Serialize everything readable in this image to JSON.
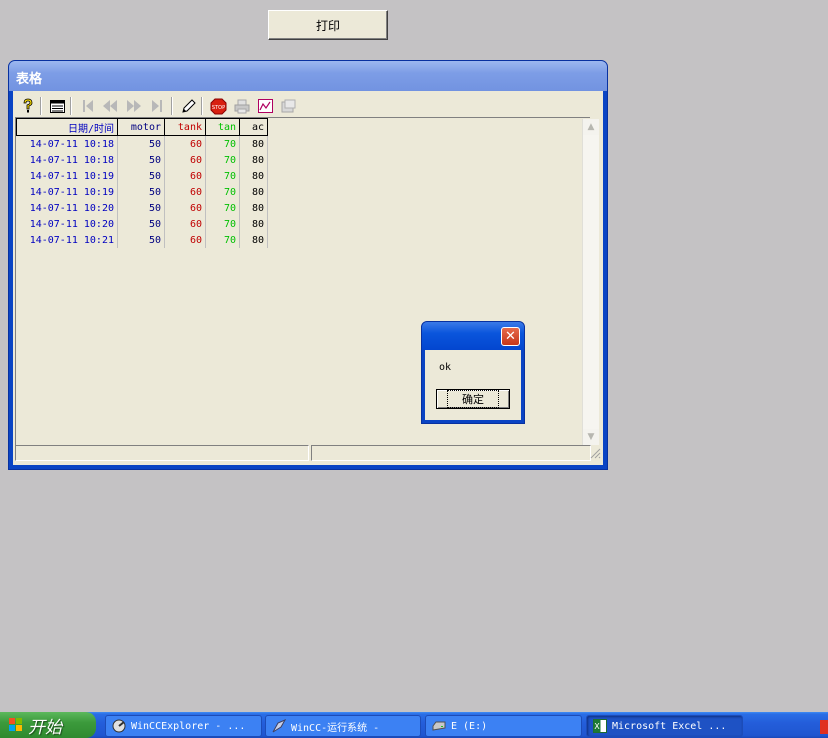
{
  "print_button": {
    "label": "打印"
  },
  "window": {
    "title": "表格"
  },
  "toolbar": {
    "icons": [
      "help-icon",
      "table-select-icon",
      "first-record-icon",
      "previous-page-icon",
      "next-page-icon",
      "last-record-icon",
      "edit-icon",
      "stop-icon",
      "print-icon",
      "chart-icon",
      "export-icon"
    ]
  },
  "table": {
    "headers": [
      "日期/时间",
      "motor",
      "tank",
      "tan",
      "ac"
    ],
    "header_colors": [
      "#0000c0",
      "#000080",
      "#c00000",
      "#00c000",
      "#000000"
    ],
    "rows": [
      [
        "14-07-11 10:18",
        "50",
        "60",
        "70",
        "80"
      ],
      [
        "14-07-11 10:18",
        "50",
        "60",
        "70",
        "80"
      ],
      [
        "14-07-11 10:19",
        "50",
        "60",
        "70",
        "80"
      ],
      [
        "14-07-11 10:19",
        "50",
        "60",
        "70",
        "80"
      ],
      [
        "14-07-11 10:20",
        "50",
        "60",
        "70",
        "80"
      ],
      [
        "14-07-11 10:20",
        "50",
        "60",
        "70",
        "80"
      ],
      [
        "14-07-11 10:21",
        "50",
        "60",
        "70",
        "80"
      ]
    ]
  },
  "message_box": {
    "text": "ok",
    "ok_label": "确定"
  },
  "taskbar": {
    "start_label": "开始",
    "tasks": [
      {
        "label": "WinCCExplorer - ...",
        "icon": "wincc-explorer-icon"
      },
      {
        "label": "WinCC-运行系统 -",
        "icon": "wincc-runtime-icon"
      },
      {
        "label": "E (E:)",
        "icon": "drive-icon"
      },
      {
        "label": "Microsoft Excel ...",
        "icon": "excel-icon"
      }
    ]
  }
}
